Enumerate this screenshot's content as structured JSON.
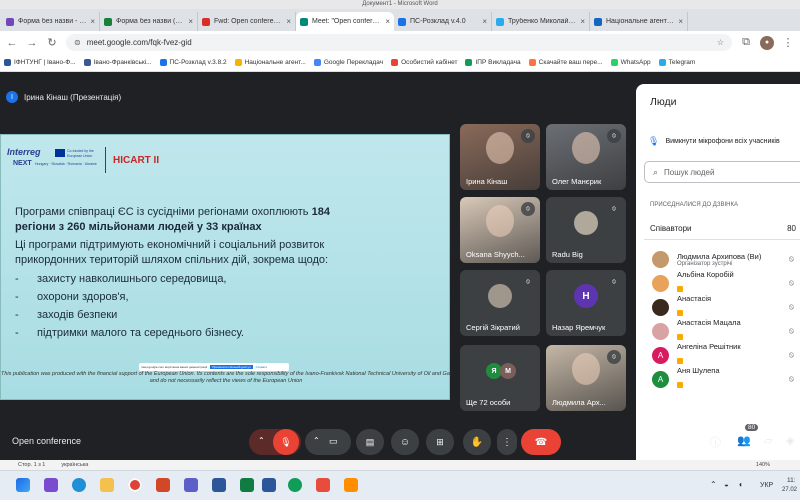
{
  "window": {
    "title": "Документ1 - Microsoft Word"
  },
  "tabs": [
    {
      "label": "Форма без назви - Google",
      "color": "#7248b9",
      "active": false
    },
    {
      "label": "Форма без назви (Відповіді)",
      "color": "#188038",
      "active": false
    },
    {
      "label": "Fwd: Open conference",
      "color": "#d93025",
      "active": false
    },
    {
      "label": "Meet: \"Open conference\"",
      "color": "#00897b",
      "active": true
    },
    {
      "label": "ПС-Розклад v.4.0",
      "color": "#1a73e8",
      "active": false
    },
    {
      "label": "Трубенко Миколайович",
      "color": "#2aabee",
      "active": false
    },
    {
      "label": "Національне агентство",
      "color": "#1565c0",
      "active": false
    }
  ],
  "toolbar": {
    "url": "meet.google.com/fqk-fvez-gid"
  },
  "bookmarks": [
    {
      "label": "ІФНТУНГ | Івано-Ф...",
      "color": "#2b5797"
    },
    {
      "label": "Івано-Франківські...",
      "color": "#3b5998"
    },
    {
      "label": "ПС-Розклад v.3.8.2",
      "color": "#1a73e8"
    },
    {
      "label": "Національне агент...",
      "color": "#f4b400"
    },
    {
      "label": "Google Перекладач",
      "color": "#4285f4"
    },
    {
      "label": "Особистий кабінет",
      "color": "#ea4335"
    },
    {
      "label": "ІПР Викладача",
      "color": "#0f9d58"
    },
    {
      "label": "Скачайте ваш пере...",
      "color": "#ff7043"
    },
    {
      "label": "WhatsApp",
      "color": "#25d366"
    },
    {
      "label": "Telegram",
      "color": "#2aabee"
    }
  ],
  "presenter": {
    "initial": "І",
    "label": "Ірина Кінаш (Презентація)"
  },
  "slide": {
    "logo_interreg": "Interreg",
    "logo_next": "NEXT",
    "logo_sub": "Hungary · Slovakia · Romania · Ukraine",
    "logo_eu": "Co-funded by the European Union",
    "project": "HICART II",
    "line1a": "Програми співпраці ЄС із сусідніми регіонами охоплюють ",
    "line1b": "184",
    "line2": "регіони з 260 мільйонами людей у 33 країнах",
    "line3": "Ці програми підтримують економічний і соціальний розвиток",
    "line4": "прикордонних територій шляхом спільних дій, зокрема щодо:",
    "items": [
      "захисту навколишнього середовища,",
      "охорони здоров'я,",
      "заходів безпеки",
      "підтримки малого та середнього бізнесу."
    ],
    "item_markers": [
      "-",
      "-",
      "-",
      "-"
    ],
    "footer1": "This publication was produced with the financial support of the European Union. Its contents are the sole responsibility of the Ivano-Frankivsk National Technical University of Oil and Gas",
    "footer2": "and do not necessarily reflect the views of the European Union"
  },
  "share_banner": {
    "text": "meet.google.com ворстання вашої демонстрації",
    "stop": "Припинити спільний доступ",
    "hide": "Сховати"
  },
  "tiles": [
    {
      "name": "Ірина Кінаш",
      "kind": "video",
      "accent": "#8a6a5a"
    },
    {
      "name": "Олег Манєрик",
      "kind": "video",
      "accent": "#6b6f75"
    },
    {
      "name": "Oksana Shyych...",
      "kind": "video",
      "accent": "#d9c9b8"
    },
    {
      "name": "Radu Big",
      "kind": "avatar",
      "accent": "#b0a89a"
    },
    {
      "name": "Сергій Зікратий",
      "kind": "avatar",
      "accent": "#a0978c"
    },
    {
      "name": "Назар Яремчук",
      "kind": "initial",
      "initial": "Н",
      "accent": "#5e35b1"
    },
    {
      "name": "Ще 72 особи",
      "kind": "more",
      "initials": [
        "Я",
        "М"
      ]
    },
    {
      "name": "Людмила Арх...",
      "kind": "video",
      "accent": "#c4b7a6"
    }
  ],
  "people_panel": {
    "title": "Люди",
    "mute_all": "Вимкнути мікрофони всіх учасників",
    "search_placeholder": "Пошук людей",
    "section": "ПРИСЄДНАЛИСЯ ДО ДЗВІНКА",
    "group_label": "Співавтори",
    "group_count": "80",
    "members": [
      {
        "name": "Людмила Архипова (Ви)",
        "role": "Організатор зустрічі",
        "color": "#c49a6c",
        "initial": ""
      },
      {
        "name": "Альбіна Коробій",
        "role": "",
        "color": "#e8a25c",
        "initial": ""
      },
      {
        "name": "Анастасія",
        "role": "",
        "color": "#3a2a1e",
        "initial": ""
      },
      {
        "name": "Анастасія Мацала",
        "role": "",
        "color": "#d9a3a3",
        "initial": ""
      },
      {
        "name": "Ангеліна Решітник",
        "role": "",
        "color": "#d81b60",
        "initial": "А"
      },
      {
        "name": "Аня Шулепа",
        "role": "",
        "color": "#1e8e3e",
        "initial": "А"
      }
    ]
  },
  "meeting": {
    "name": "Open conference",
    "participants_badge": "80"
  },
  "taskbar": {
    "lang": "УКР",
    "time": "11:",
    "date": "27.02"
  },
  "word_status": {
    "page": "Стор. 1 з 1",
    "lang": "українська",
    "zoom": "140%"
  }
}
